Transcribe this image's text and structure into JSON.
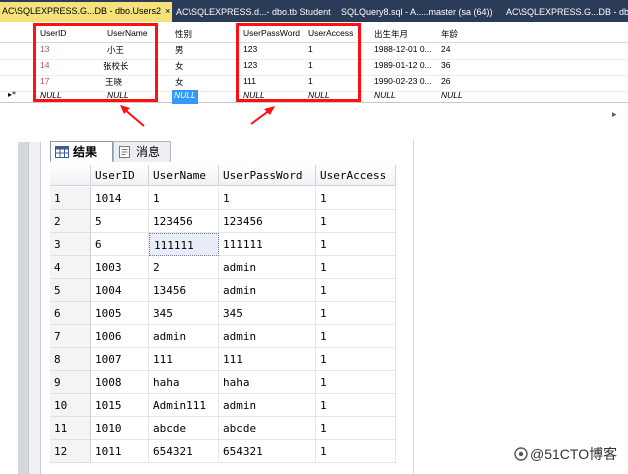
{
  "tabs": [
    {
      "label": "AC\\SQLEXPRESS.G...DB - dbo.Users2",
      "close": "×",
      "active": true
    },
    {
      "label": "AC\\SQLEXPRESS.d...- dbo.tb Student",
      "active": false
    },
    {
      "label": "SQLQuery8.sql - A.....master (sa (64))",
      "active": false
    },
    {
      "label": "AC\\SQLEXPRESS.G...DB - dbo.U",
      "active": false
    }
  ],
  "top_grid": {
    "headers": [
      "UserID",
      "UserName",
      "性别",
      "UserPassWord",
      "UserAccess",
      "出生年月",
      "年龄"
    ],
    "rows": [
      [
        "13",
        "小王",
        "男",
        "123",
        "1",
        "1988-12-01 0...",
        "24"
      ],
      [
        "14",
        "张校长",
        "女",
        "123",
        "1",
        "1989-01-12 0...",
        "36"
      ],
      [
        "17",
        "王晓",
        "女",
        "111",
        "1",
        "1990-02-23 0...",
        "26"
      ]
    ],
    "new_row_marker": "▸*",
    "null_row": [
      "NULL",
      "NULL",
      "NULL",
      "NULL",
      "NULL",
      "NULL",
      "NULL"
    ]
  },
  "results_panel": {
    "tabs": [
      {
        "label": "结果",
        "icon": "grid-icon",
        "active": true
      },
      {
        "label": "消息",
        "icon": "messages-icon",
        "active": false
      }
    ],
    "columns": [
      "UserID",
      "UserName",
      "UserPassWord",
      "UserAccess"
    ],
    "rows": [
      {
        "num": "1",
        "cells": [
          "1014",
          "1",
          "1",
          "1"
        ]
      },
      {
        "num": "2",
        "cells": [
          "5",
          "123456",
          "123456",
          "1"
        ]
      },
      {
        "num": "3",
        "cells": [
          "6",
          "111111",
          "111111",
          "1"
        ]
      },
      {
        "num": "4",
        "cells": [
          "1003",
          "2",
          "admin",
          "1"
        ]
      },
      {
        "num": "5",
        "cells": [
          "1004",
          "13456",
          "admin",
          "1"
        ]
      },
      {
        "num": "6",
        "cells": [
          "1005",
          "345",
          "345",
          "1"
        ]
      },
      {
        "num": "7",
        "cells": [
          "1006",
          "admin",
          "admin",
          "1"
        ]
      },
      {
        "num": "8",
        "cells": [
          "1007",
          "111",
          "111",
          "1"
        ]
      },
      {
        "num": "9",
        "cells": [
          "1008",
          "haha",
          "haha",
          "1"
        ]
      },
      {
        "num": "10",
        "cells": [
          "1015",
          "Admin111",
          "admin",
          "1"
        ]
      },
      {
        "num": "11",
        "cells": [
          "1010",
          "abcde",
          "abcde",
          "1"
        ]
      },
      {
        "num": "12",
        "cells": [
          "1011",
          "654321",
          "654321",
          "1"
        ]
      }
    ]
  },
  "watermark": "@51CTO博客",
  "colors": {
    "tab_strip": "#2b3c59",
    "active_tab": "#f6e27a",
    "highlight_box": "#ff1111",
    "selection": "#3399ff"
  }
}
